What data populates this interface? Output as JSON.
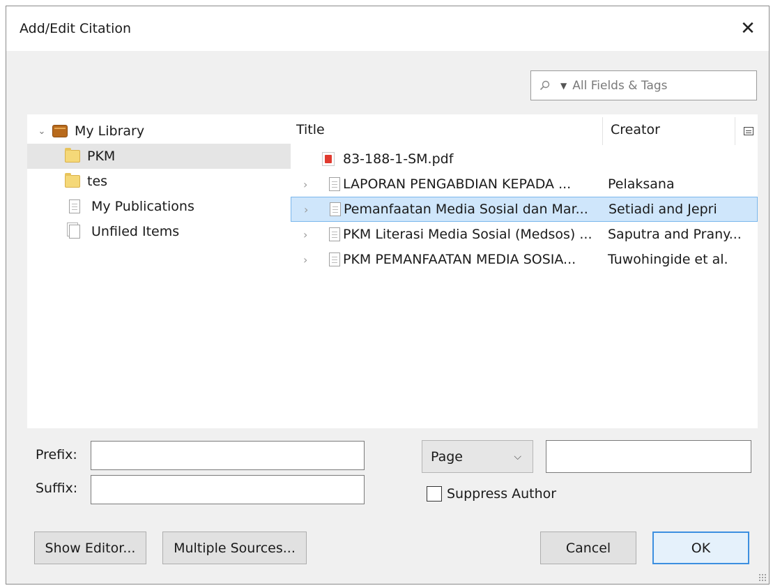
{
  "dialog": {
    "title": "Add/Edit Citation",
    "close_glyph": "✕"
  },
  "search": {
    "placeholder": "All Fields & Tags",
    "icon": "search-icon",
    "mode_caret": "▼"
  },
  "library": {
    "collections": [
      {
        "label": "My Library",
        "icon": "library-icon",
        "expanded": true,
        "selected": false
      },
      {
        "label": "PKM",
        "icon": "folder-icon",
        "selected": true
      },
      {
        "label": "tes",
        "icon": "folder-icon",
        "selected": false
      },
      {
        "label": "My Publications",
        "icon": "document-icon",
        "selected": false
      },
      {
        "label": "Unfiled Items",
        "icon": "unfiled-icon",
        "selected": false
      }
    ]
  },
  "items": {
    "columns": {
      "title": "Title",
      "creator": "Creator"
    },
    "rows": [
      {
        "title": "83-188-1-SM.pdf",
        "creator": "",
        "icon": "pdf-icon",
        "expandable": false,
        "selected": false
      },
      {
        "title": "LAPORAN PENGABDIAN KEPADA ...",
        "creator": "Pelaksana",
        "icon": "document-icon",
        "expandable": true,
        "selected": false
      },
      {
        "title": "Pemanfaatan Media Sosial dan Mar...",
        "creator": "Setiadi and Jepri",
        "icon": "document-icon",
        "expandable": true,
        "selected": true
      },
      {
        "title": "PKM Literasi Media Sosial (Medsos) ...",
        "creator": "Saputra and Prany...",
        "icon": "document-icon",
        "expandable": true,
        "selected": false
      },
      {
        "title": "PKM PEMANFAATAN MEDIA SOSIA...",
        "creator": "Tuwohingide et al.",
        "icon": "document-icon",
        "expandable": true,
        "selected": false
      }
    ]
  },
  "citation": {
    "prefix_label": "Prefix:",
    "prefix_value": "",
    "suffix_label": "Suffix:",
    "suffix_value": "",
    "locator_selected": "Page",
    "locator_value": "",
    "suppress_author_label": "Suppress Author",
    "suppress_author_checked": false
  },
  "buttons": {
    "show_editor": "Show Editor...",
    "multiple_sources": "Multiple Sources...",
    "cancel": "Cancel",
    "ok": "OK"
  },
  "colors": {
    "selection_bg": "#cfe6fb",
    "selection_border": "#7ab7ec",
    "default_button_border": "#3c8fe0"
  }
}
